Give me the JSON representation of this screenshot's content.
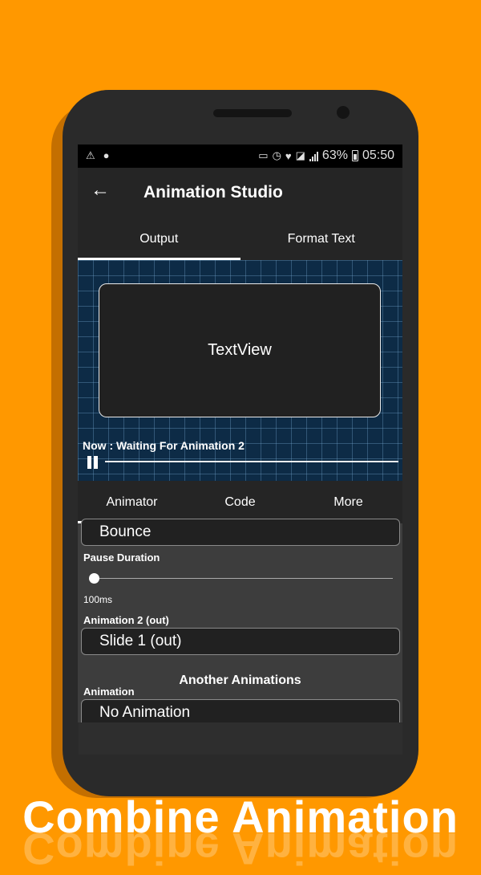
{
  "status": {
    "battery": "63%",
    "time": "05:50"
  },
  "appbar": {
    "title": "Animation Studio"
  },
  "tabs_top": [
    {
      "label": "Output"
    },
    {
      "label": "Format Text"
    }
  ],
  "preview": {
    "textview": "TextView",
    "status_text": "Now : Waiting For Animation 2"
  },
  "tabs_bottom": [
    {
      "label": "Animator"
    },
    {
      "label": "Code"
    },
    {
      "label": "More"
    }
  ],
  "panel": {
    "animation1_value": "Bounce",
    "pause_label": "Pause Duration",
    "pause_value": "100ms",
    "animation2_label": "Animation 2 (out)",
    "animation2_value": "Slide 1 (out)",
    "section_title": "Another Animations",
    "animation_label": "Animation",
    "animation_value": "No Animation"
  },
  "banner": "Combine Animation"
}
